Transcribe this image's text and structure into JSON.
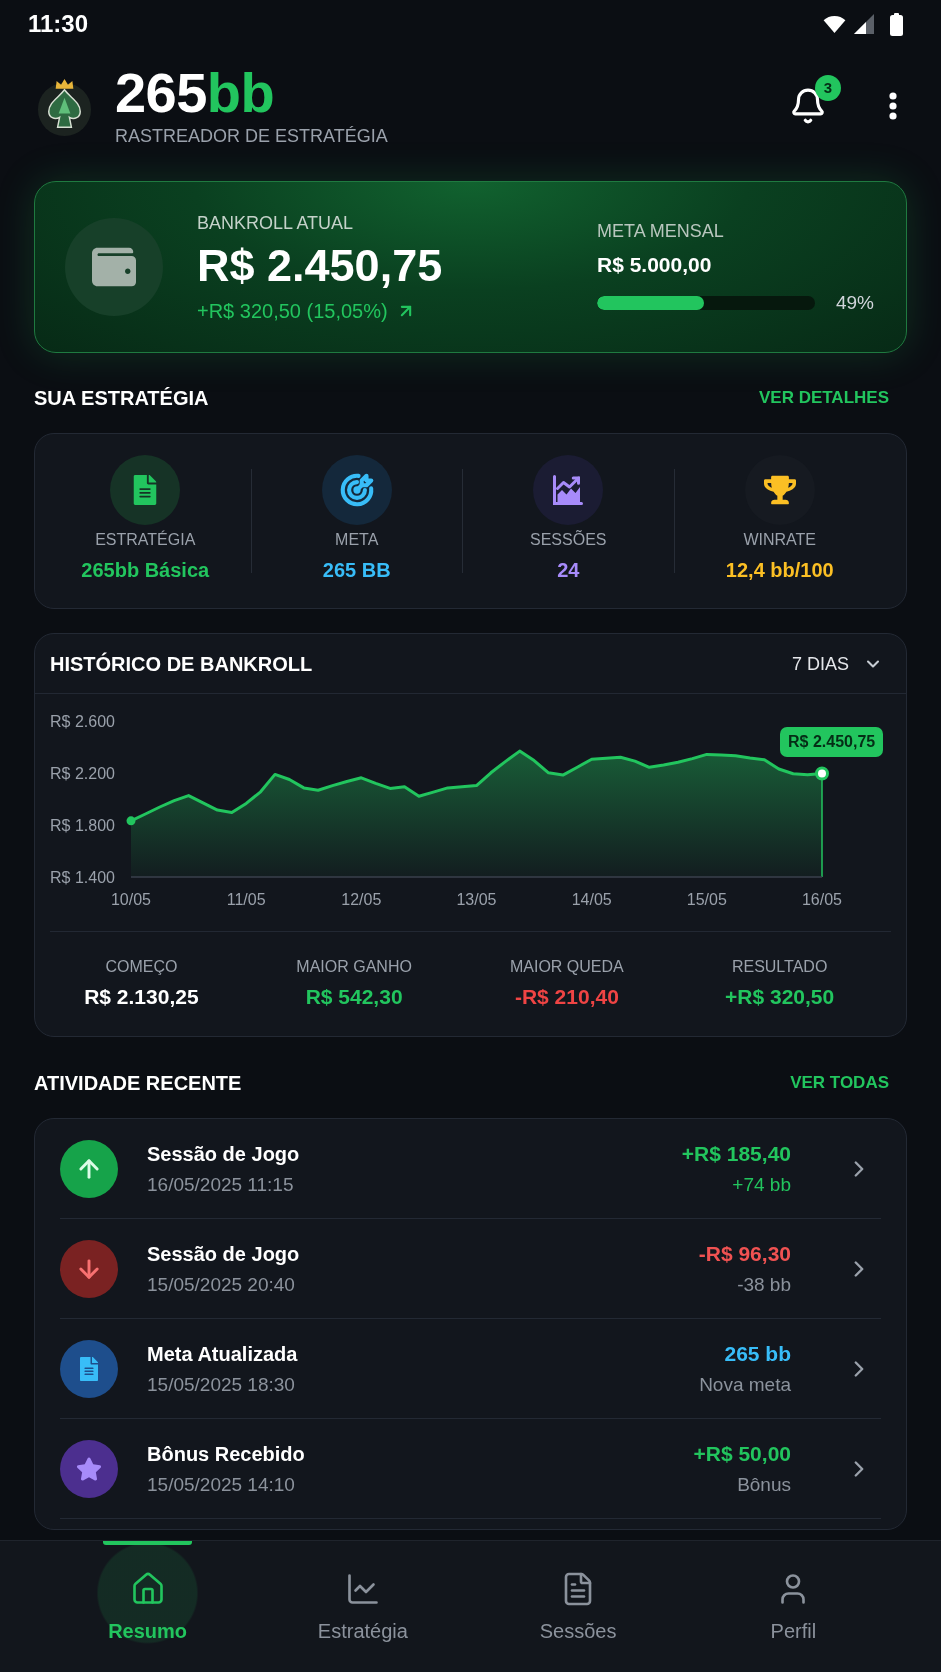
{
  "status_bar": {
    "time": "11:30"
  },
  "header": {
    "app_name": "265**bb**",
    "subtitle": "RASTREADOR DE ESTRATÉGIA",
    "notifications": {
      "count": "3"
    }
  },
  "bankroll": {
    "label": "BANKROLL ATUAL",
    "amount": "R$ 2.450,75",
    "change": "+R$ 320,50 (15,05%)",
    "goal": {
      "label": "META MENSAL",
      "amount": "R$ 5.000,00",
      "level": 0.49,
      "percent": "49%"
    }
  },
  "strategy": {
    "title": "SUA ESTRATÉGIA",
    "link": "VER DETALHES",
    "stats": [
      {
        "kind": "document",
        "label": "ESTRATÉGIA",
        "value": "265bb Básica",
        "color": "#22c55e"
      },
      {
        "kind": "target",
        "label": "META",
        "value": "265 BB",
        "color": "#38bdf8"
      },
      {
        "kind": "chart",
        "label": "SESSÕES",
        "value": "24",
        "color": "#a78bfa"
      },
      {
        "kind": "trophy",
        "label": "WINRATE",
        "value": "12,4 bb/100",
        "color": "#fbbf24"
      }
    ]
  },
  "history": {
    "title": "HISTÓRICO DE BANKROLL",
    "period": "7 DIAS",
    "y_axis_labels": [
      "R$ 2.600",
      "R$ 2.200",
      "R$ 1.800",
      "R$ 1.400"
    ],
    "x_axis_labels": [
      "10/05",
      "11/05",
      "12/05",
      "13/05",
      "14/05",
      "15/05",
      "16/05"
    ],
    "tooltip": "R$ 2.450,75",
    "summary": [
      {
        "label": "COMEÇO",
        "value": "R$ 2.130,25",
        "color": "#ffffff"
      },
      {
        "label": "MAIOR GANHO",
        "value": "R$ 542,30",
        "color": "#22c55e"
      },
      {
        "label": "MAIOR QUEDA",
        "value": "-R$ 210,40",
        "color": "#ef4444"
      },
      {
        "label": "RESULTADO",
        "value": "+R$ 320,50",
        "color": "#22c55e"
      }
    ]
  },
  "activity": {
    "title": "ATIVIDADE RECENTE",
    "link": "VER TODAS",
    "items": [
      {
        "kind": "gain",
        "title": "Sessão de Jogo",
        "date": "16/05/2025 11:15",
        "amount": "+R$ 185,40",
        "detail": "+74 bb",
        "color": "#22c55e"
      },
      {
        "kind": "loss",
        "title": "Sessão de Jogo",
        "date": "15/05/2025 20:40",
        "amount": "-R$ 96,30",
        "detail": "-38 bb",
        "color": "#f05252"
      },
      {
        "kind": "goal",
        "title": "Meta Atualizada",
        "date": "15/05/2025 18:30",
        "amount": "265 bb",
        "detail": "Nova meta",
        "color": "#38bdf8"
      },
      {
        "kind": "bonus",
        "title": "Bônus Recebido",
        "date": "15/05/2025 14:10",
        "amount": "+R$ 50,00",
        "detail": "Bônus",
        "color": "#22c55e"
      }
    ]
  },
  "bottom_nav": [
    {
      "kind": "home",
      "label": "Resumo",
      "selected": true
    },
    {
      "kind": "chart",
      "label": "Estratégia",
      "selected": false
    },
    {
      "kind": "document",
      "label": "Sessões",
      "selected": false
    },
    {
      "kind": "user",
      "label": "Perfil",
      "selected": false
    }
  ]
}
